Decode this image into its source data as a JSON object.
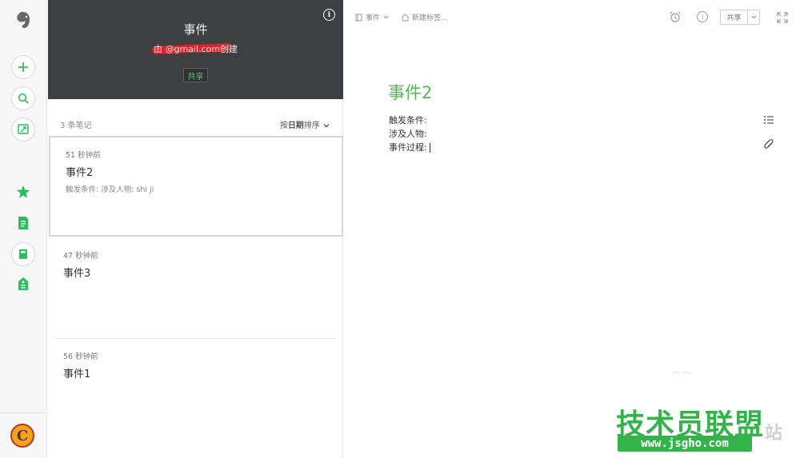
{
  "rail": {
    "logo": "elephant-logo",
    "buttons": [
      "new-note",
      "search",
      "work-chat"
    ],
    "nav": [
      "shortcuts",
      "notes",
      "notebooks",
      "tags"
    ],
    "avatar_letter": "C"
  },
  "notebook": {
    "title": "事件",
    "creator": "由 @gmail.com创建",
    "share_label": "共享",
    "note_count": "3 条笔记",
    "sort_prefix": "按",
    "sort_key": "日期",
    "sort_suffix": "排序"
  },
  "notes": [
    {
      "time": "51 秒钟前",
      "title": "事件2",
      "snippet": "触发条件:  涉及人物:  shi ji"
    },
    {
      "time": "47 秒钟前",
      "title": "事件3",
      "snippet": ""
    },
    {
      "time": "56 秒钟前",
      "title": "事件1",
      "snippet": ""
    }
  ],
  "editor": {
    "notebook_label": "事件",
    "tag_placeholder": "新建标签...",
    "share_label": "共享",
    "title": "事件2",
    "lines": [
      "触发条件:",
      "涉及人物:",
      "事件过程:"
    ]
  },
  "watermark": {
    "main": "技术员联盟",
    "url": "www.jsgho.com",
    "side": "站"
  },
  "colors": {
    "accent": "#2dbe60",
    "header_bg": "#3d3f41",
    "title_green": "#58b35a"
  }
}
